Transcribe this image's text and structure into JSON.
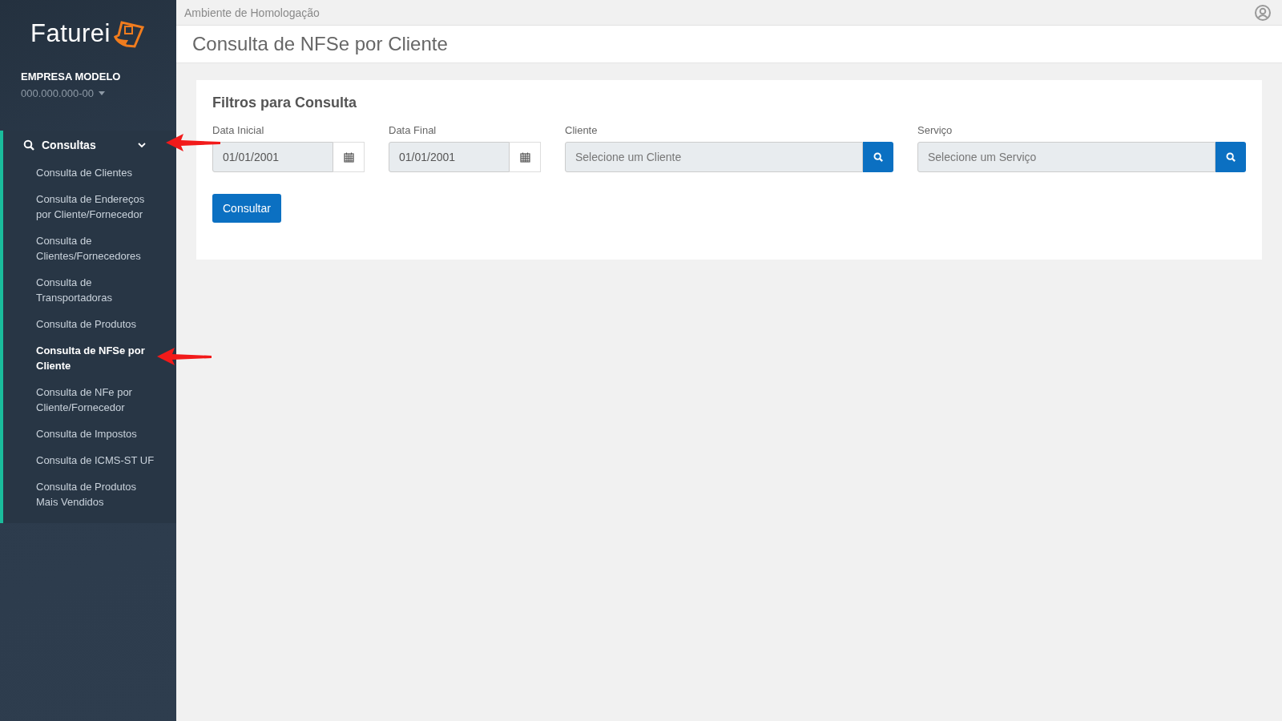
{
  "sidebar": {
    "logo_text": "Faturei",
    "company": {
      "name": "EMPRESA MODELO",
      "document": "000.000.000-00"
    },
    "menu": {
      "label": "Consultas",
      "expanded": true,
      "items": [
        {
          "label": "Consulta de Clientes",
          "selected": false
        },
        {
          "label": "Consulta de Endereços por Cliente/Fornecedor",
          "selected": false
        },
        {
          "label": "Consulta de Clientes/Fornecedores",
          "selected": false
        },
        {
          "label": "Consulta de Transportadoras",
          "selected": false
        },
        {
          "label": "Consulta de Produtos",
          "selected": false
        },
        {
          "label": "Consulta de NFSe por Cliente",
          "selected": true
        },
        {
          "label": "Consulta de NFe por Cliente/Fornecedor",
          "selected": false
        },
        {
          "label": "Consulta de Impostos",
          "selected": false
        },
        {
          "label": "Consulta de ICMS-ST UF",
          "selected": false
        },
        {
          "label": "Consulta de Produtos Mais Vendidos",
          "selected": false
        }
      ]
    }
  },
  "top_bar": {
    "environment": "Ambiente de Homologação"
  },
  "page_title": "Consulta de NFSe por Cliente",
  "filters": {
    "title": "Filtros para Consulta",
    "fields": [
      {
        "kind": "date",
        "label": "Data Inicial",
        "value": "01/01/2001"
      },
      {
        "kind": "date",
        "label": "Data Final",
        "value": "01/01/2001"
      },
      {
        "kind": "lookup",
        "label": "Cliente",
        "placeholder": "Selecione um Cliente"
      },
      {
        "kind": "lookup",
        "label": "Serviço",
        "placeholder": "Selecione um Serviço"
      }
    ],
    "button": "Consultar"
  }
}
